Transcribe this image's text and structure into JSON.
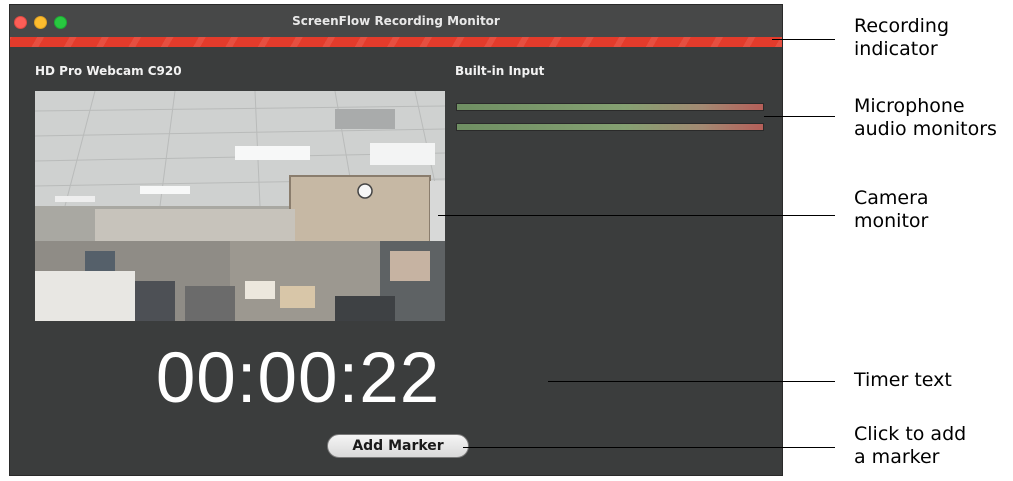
{
  "window": {
    "title": "ScreenFlow Recording Monitor"
  },
  "camera": {
    "label": "HD Pro Webcam C920"
  },
  "audio": {
    "label": "Built-in Input"
  },
  "timer": {
    "text": "00:00:22"
  },
  "marker_button": {
    "label": "Add Marker"
  },
  "callouts": {
    "recording": [
      "Recording",
      "indicator"
    ],
    "microphone": [
      "Microphone",
      "audio monitors"
    ],
    "camera": [
      "Camera",
      "monitor"
    ],
    "timer": [
      "Timer text"
    ],
    "marker": [
      "Click to add",
      "a marker"
    ]
  },
  "colors": {
    "recording_indicator": "#e33b2b",
    "window_bg": "#3b3d3d"
  }
}
